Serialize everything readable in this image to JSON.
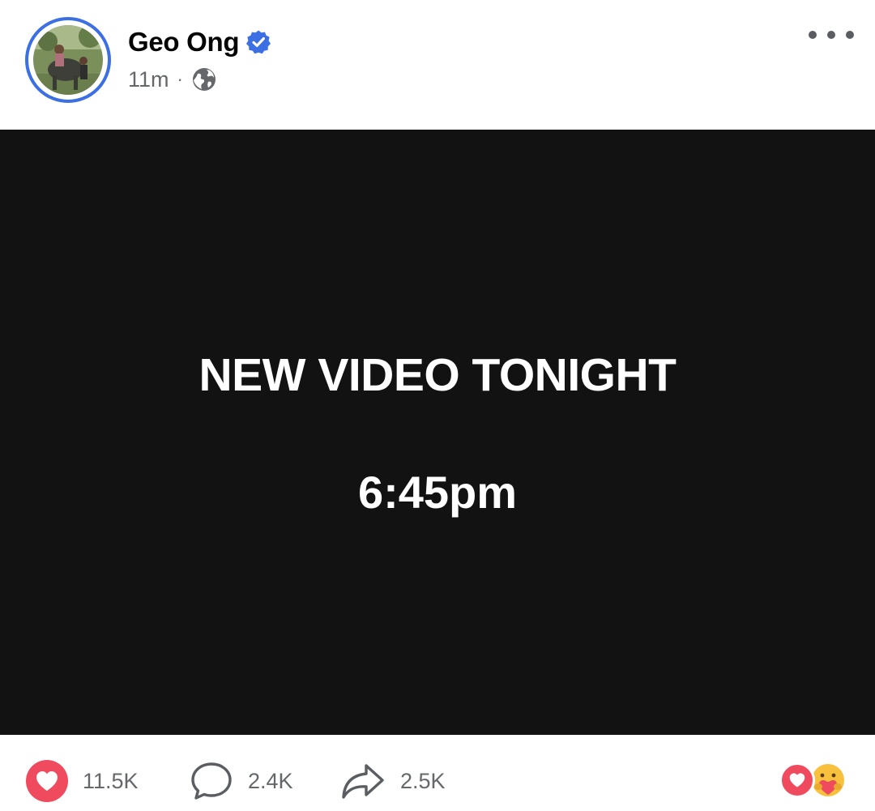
{
  "post": {
    "author": {
      "name": "Geo Ong",
      "verified": true,
      "avatar_icon": "profile-photo"
    },
    "timestamp": "11m",
    "separator": "·",
    "audience_icon": "globe-icon",
    "more_icon": "more-options-icon"
  },
  "media": {
    "background": "#121212",
    "headline": "NEW VIDEO TONIGHT",
    "time": "6:45pm"
  },
  "actions": {
    "like": {
      "icon": "heart-icon",
      "count": "11.5K"
    },
    "comment": {
      "icon": "comment-icon",
      "count": "2.4K"
    },
    "share": {
      "icon": "share-icon",
      "count": "2.5K"
    }
  },
  "reactions": [
    "love",
    "care"
  ],
  "colors": {
    "accent": "#3b6fe3",
    "love": "#f04a5e",
    "muted_text": "#65676b"
  }
}
